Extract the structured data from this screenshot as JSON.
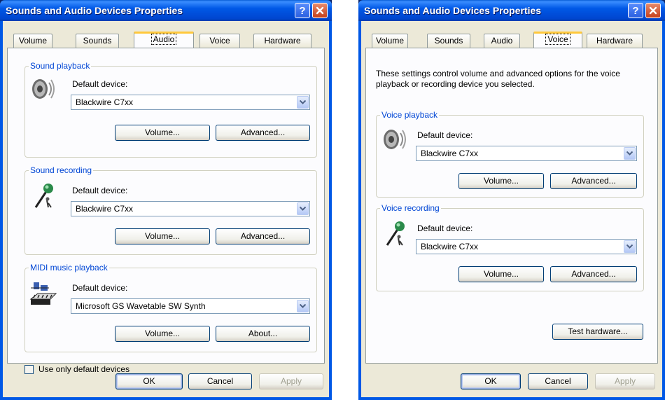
{
  "left_window": {
    "title": "Sounds and Audio Devices Properties",
    "tabs": [
      "Volume",
      "Sounds",
      "Audio",
      "Voice",
      "Hardware"
    ],
    "active_tab": "Audio",
    "sound_playback": {
      "legend": "Sound playback",
      "device_label": "Default device:",
      "device": "Blackwire C7xx",
      "volume_button": "Volume...",
      "advanced_button": "Advanced..."
    },
    "sound_recording": {
      "legend": "Sound recording",
      "device_label": "Default device:",
      "device": "Blackwire C7xx",
      "volume_button": "Volume...",
      "advanced_button": "Advanced..."
    },
    "midi_playback": {
      "legend": "MIDI music playback",
      "device_label": "Default device:",
      "device": "Microsoft GS Wavetable SW Synth",
      "volume_button": "Volume...",
      "about_button": "About..."
    },
    "use_default_checkbox": "Use only default devices",
    "footer": {
      "ok": "OK",
      "cancel": "Cancel",
      "apply": "Apply"
    }
  },
  "right_window": {
    "title": "Sounds and Audio Devices Properties",
    "tabs": [
      "Volume",
      "Sounds",
      "Audio",
      "Voice",
      "Hardware"
    ],
    "active_tab": "Voice",
    "info_text": "These settings control volume and advanced options for the voice playback or recording device you selected.",
    "voice_playback": {
      "legend": "Voice playback",
      "device_label": "Default device:",
      "device": "Blackwire C7xx",
      "volume_button": "Volume...",
      "advanced_button": "Advanced..."
    },
    "voice_recording": {
      "legend": "Voice recording",
      "device_label": "Default device:",
      "device": "Blackwire C7xx",
      "volume_button": "Volume...",
      "advanced_button": "Advanced..."
    },
    "test_hardware_button": "Test hardware...",
    "footer": {
      "ok": "OK",
      "cancel": "Cancel",
      "apply": "Apply"
    }
  },
  "colors": {
    "title_bar": "#0058e6",
    "dialog_bg": "#ece9d8",
    "group_legend": "#0046d5",
    "active_tab_highlight": "#ffc83c"
  },
  "icons": [
    "speaker-icon",
    "microphone-icon",
    "midi-keyboard-icon",
    "help-icon",
    "close-icon",
    "dropdown-arrow-icon"
  ]
}
